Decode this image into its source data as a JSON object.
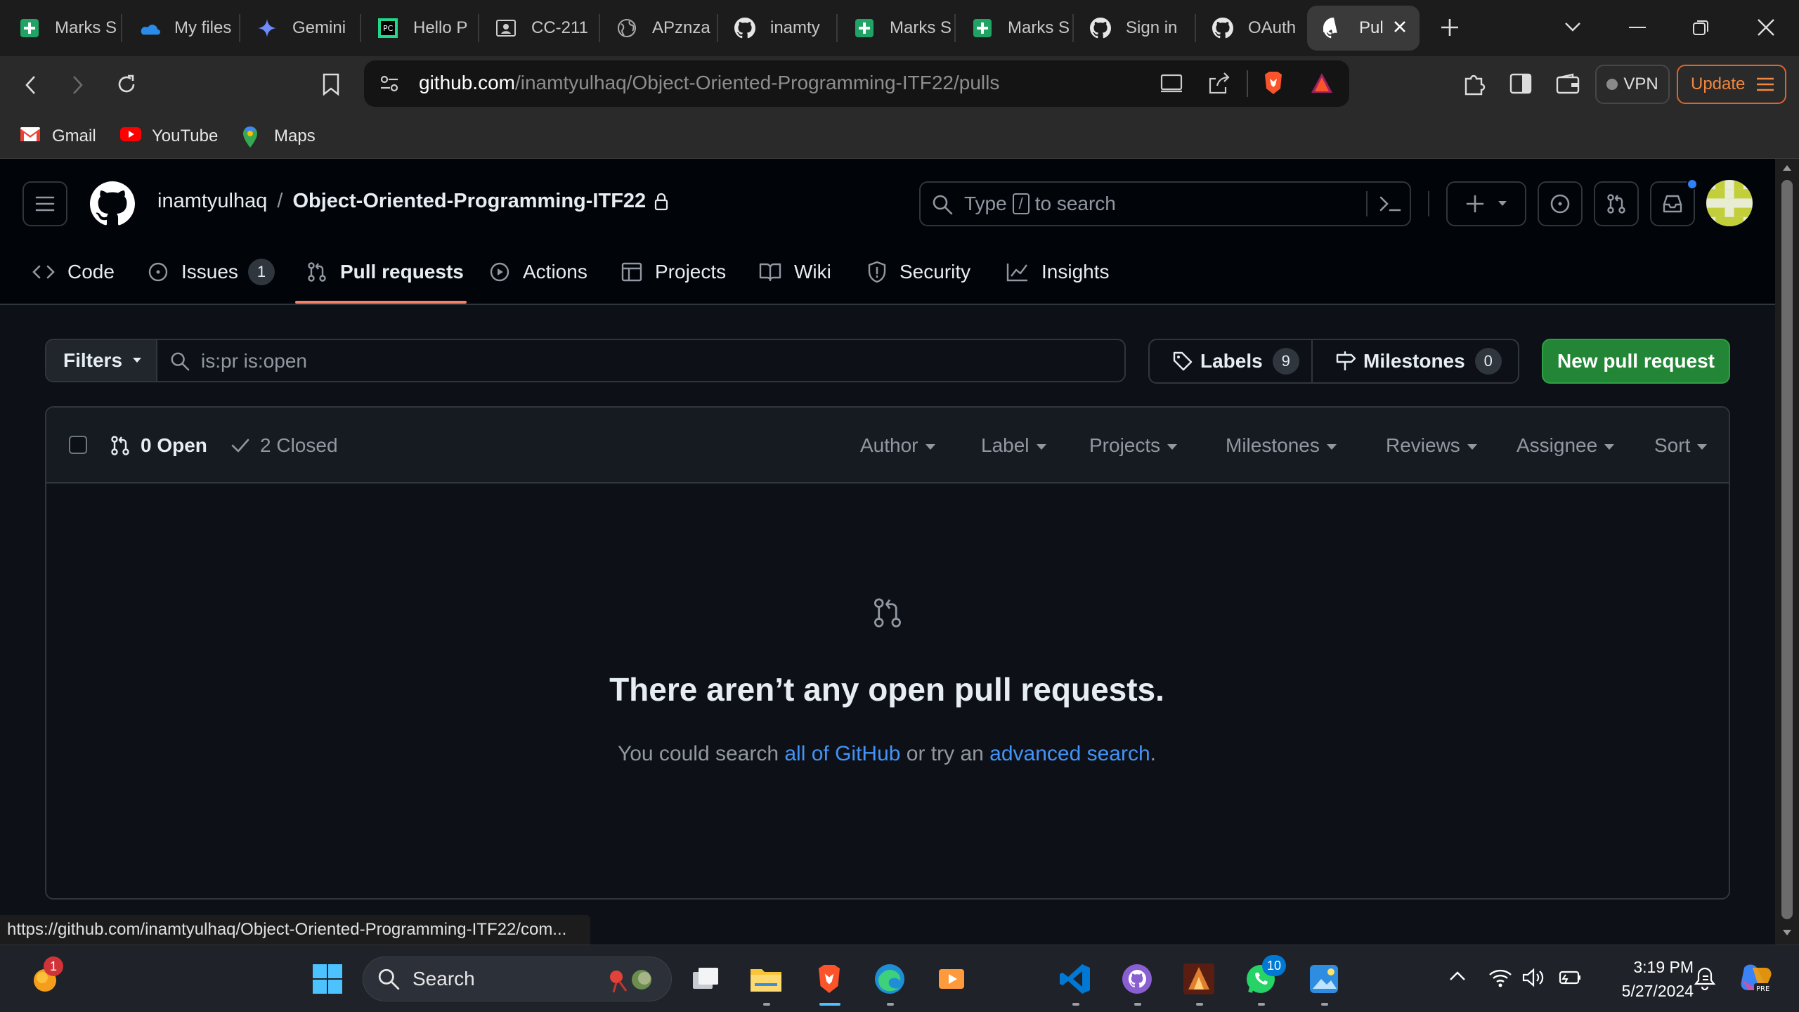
{
  "browser": {
    "tabs": [
      {
        "label": "Marks S",
        "icon": "sheets-plus-icon"
      },
      {
        "label": "My files",
        "icon": "onedrive-icon"
      },
      {
        "label": "Gemini",
        "icon": "gemini-icon"
      },
      {
        "label": "Hello P",
        "icon": "pycharm-icon"
      },
      {
        "label": "CC-211",
        "icon": "classroom-icon"
      },
      {
        "label": "APznza",
        "icon": "globe-icon"
      },
      {
        "label": "inamty",
        "icon": "github-icon"
      },
      {
        "label": "Marks S",
        "icon": "sheets-plus-icon"
      },
      {
        "label": "Marks S",
        "icon": "sheets-plus-icon"
      },
      {
        "label": "Sign in",
        "icon": "github-icon"
      },
      {
        "label": "OAuth",
        "icon": "github-icon"
      },
      {
        "label": "Pul",
        "icon": "github-icon"
      }
    ],
    "url_host": "github.com",
    "url_path": "/inamtyulhaq/Object-Oriented-Programming-ITF22/pulls",
    "vpn_label": "VPN",
    "update_label": "Update",
    "bookmarks": [
      {
        "label": "Gmail",
        "icon": "gmail-icon"
      },
      {
        "label": "YouTube",
        "icon": "youtube-icon"
      },
      {
        "label": "Maps",
        "icon": "maps-icon"
      }
    ],
    "status_url": "https://github.com/inamtyulhaq/Object-Oriented-Programming-ITF22/com..."
  },
  "github": {
    "owner": "inamtyulhaq",
    "separator": "/",
    "repo": "Object-Oriented-Programming-ITF22",
    "search_placeholder_prefix": "Type",
    "search_key": "/",
    "search_placeholder_suffix": "to search",
    "nav": [
      {
        "label": "Code",
        "icon": "code-icon"
      },
      {
        "label": "Issues",
        "icon": "issue-icon",
        "count": "1"
      },
      {
        "label": "Pull requests",
        "icon": "pull-request-icon",
        "selected": true
      },
      {
        "label": "Actions",
        "icon": "play-icon"
      },
      {
        "label": "Projects",
        "icon": "table-icon"
      },
      {
        "label": "Wiki",
        "icon": "book-icon"
      },
      {
        "label": "Security",
        "icon": "shield-icon"
      },
      {
        "label": "Insights",
        "icon": "graph-icon"
      }
    ],
    "filters_label": "Filters",
    "filter_query": "is:pr is:open",
    "labels_label": "Labels",
    "labels_count": "9",
    "milestones_label": "Milestones",
    "milestones_count": "0",
    "new_pr_label": "New pull request",
    "open_label": "0 Open",
    "closed_label": "2 Closed",
    "sort_menus": [
      "Author",
      "Label",
      "Projects",
      "Milestones",
      "Reviews",
      "Assignee",
      "Sort"
    ],
    "blank_title": "There aren’t any open pull requests.",
    "blank_sub_prefix": "You could search ",
    "blank_sub_link1": "all of GitHub",
    "blank_sub_middle": " or try an ",
    "blank_sub_link2": "advanced search",
    "blank_sub_suffix": "."
  },
  "taskbar": {
    "search_label": "Search",
    "notification_badge": "1",
    "whatsapp_badge": "10",
    "time": "3:19 PM",
    "date": "5/27/2024"
  },
  "colors": {
    "accent_green": "#238636",
    "link_blue": "#4493f8",
    "selected_underline": "#f78166"
  }
}
